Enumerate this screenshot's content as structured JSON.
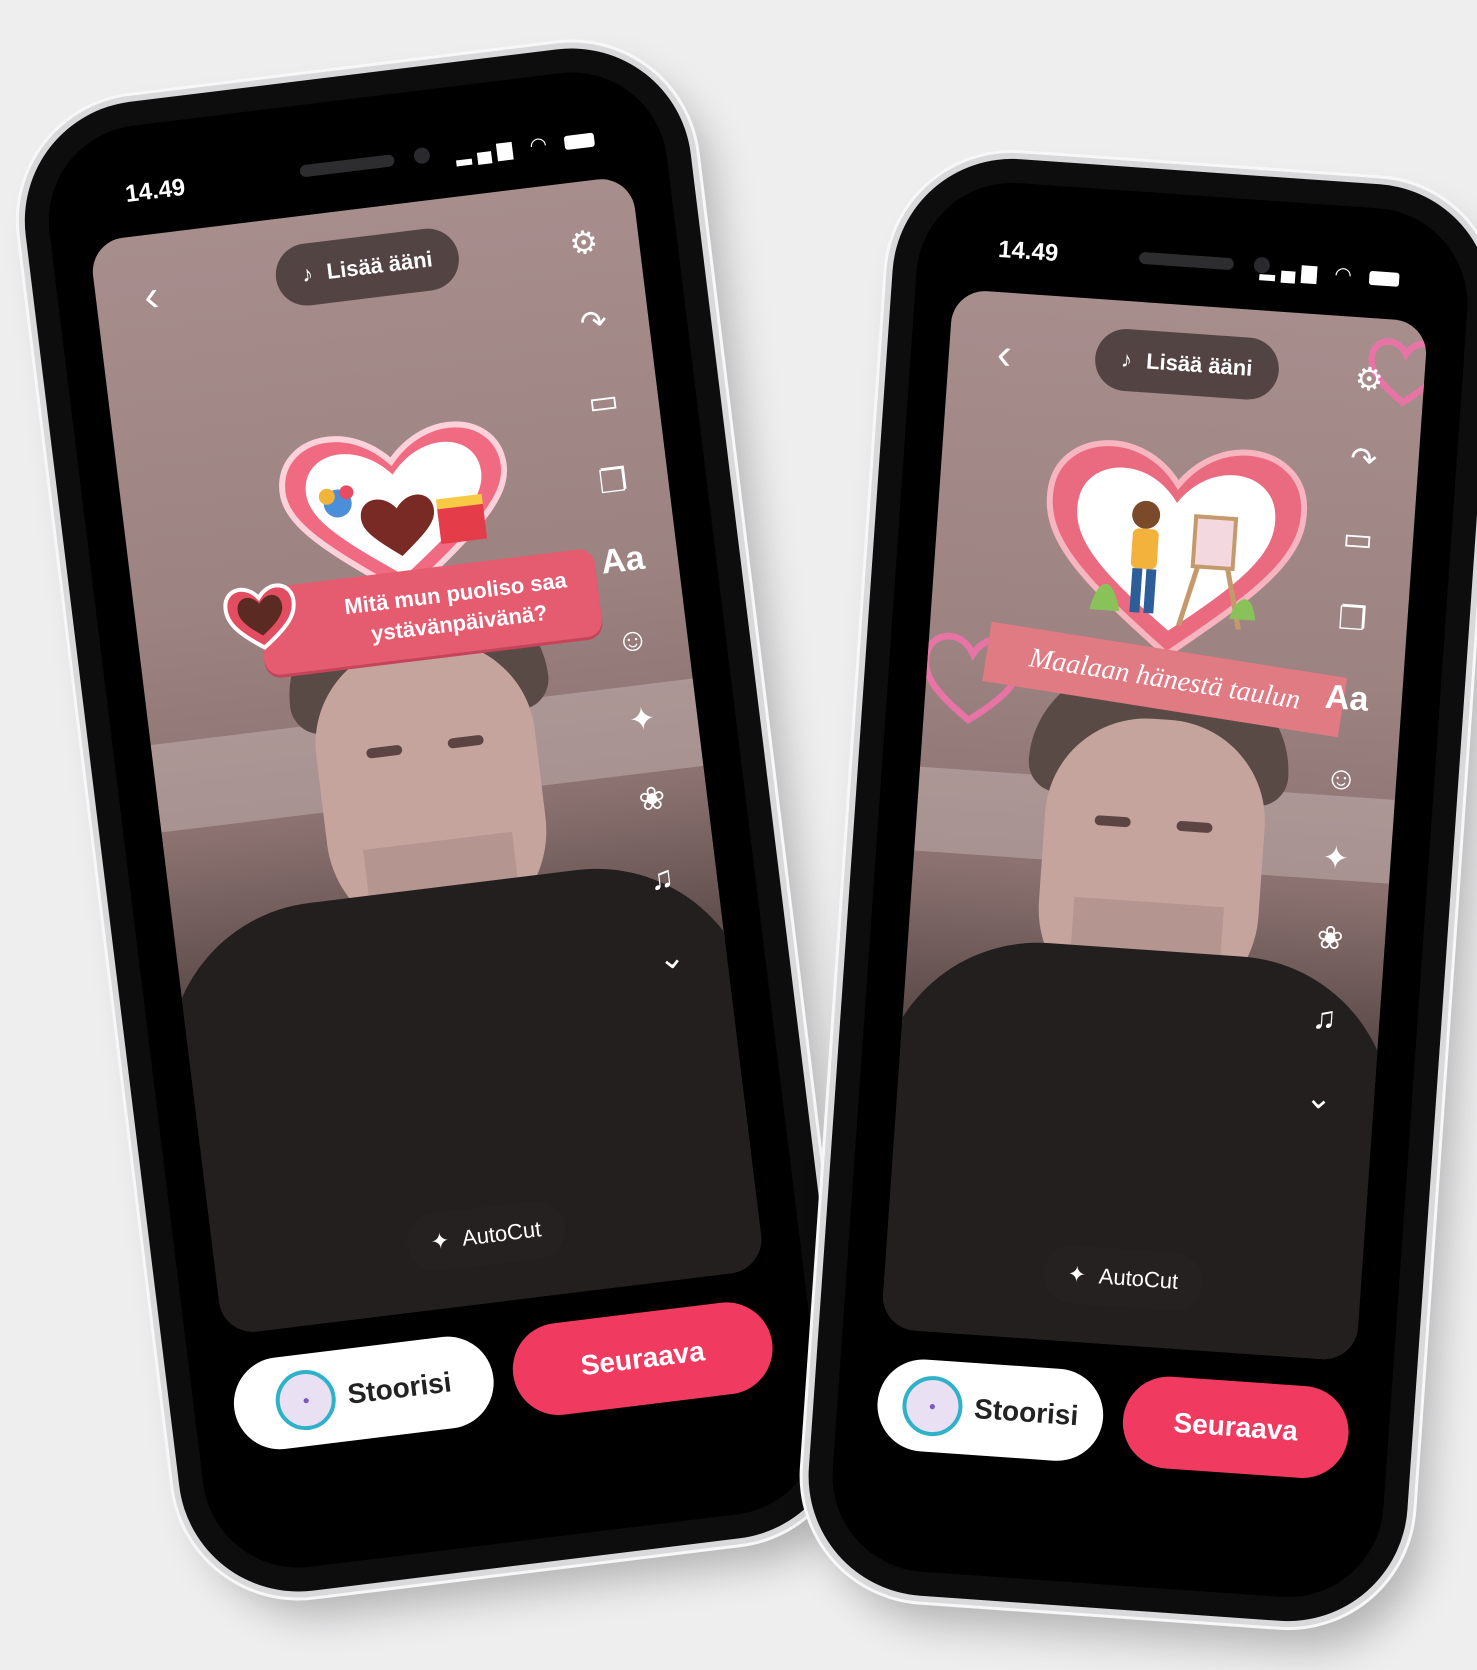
{
  "screens": [
    {
      "status": {
        "time": "14.49"
      },
      "add_sound": "Lisää ääni",
      "sticker": {
        "question": "Mitä mun puoliso saa ystävänpäivänä?"
      },
      "autocut": "AutoCut",
      "buttons": {
        "story": "Stoorisi",
        "next": "Seuraava"
      },
      "toolbar": {
        "text_tool": "Aa"
      }
    },
    {
      "status": {
        "time": "14.49"
      },
      "add_sound": "Lisää ääni",
      "sticker": {
        "answer": "Maalaan hänestä taulun"
      },
      "autocut": "AutoCut",
      "buttons": {
        "story": "Stoorisi",
        "next": "Seuraava"
      },
      "toolbar": {
        "text_tool": "Aa"
      }
    }
  ],
  "colors": {
    "accent": "#f13a60",
    "sticker_pink": "#e55b6f",
    "banner_pink": "#e07a83"
  },
  "icons": {
    "toolbar": [
      "settings-icon",
      "share-icon",
      "crop-icon",
      "template-icon",
      "text-icon",
      "sticker-icon",
      "effects-icon",
      "filters-icon",
      "voice-effect-icon",
      "more-chevron-icon"
    ]
  }
}
